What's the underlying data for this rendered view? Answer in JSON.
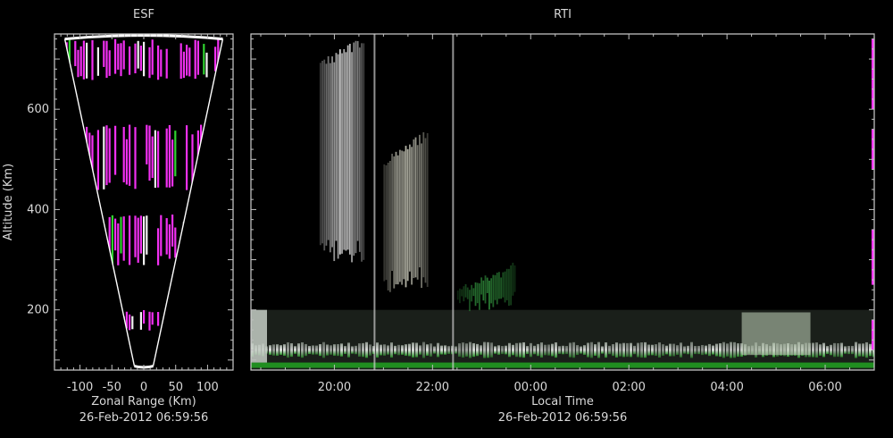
{
  "chart_data": [
    {
      "type": "heatmap",
      "title": "ESF",
      "xlabel": "Zonal Range (Km)",
      "ylabel": "Altitude (Km)",
      "timestamp": "26-Feb-2012 06:59:56",
      "xlim": [
        -140,
        140
      ],
      "ylim": [
        80,
        750
      ],
      "x_ticks": [
        -100,
        -50,
        0,
        50,
        100
      ],
      "x_tick_labels": [
        "-100",
        "-50",
        "0",
        "50",
        "100"
      ],
      "y_ticks": [
        200,
        400,
        600
      ],
      "y_tick_labels": [
        "200",
        "400",
        "600"
      ],
      "fan_half_angle_deg": 9.5,
      "echo_bands_altitude_km": [
        [
          160,
          200
        ],
        [
          290,
          390
        ],
        [
          440,
          570
        ],
        [
          660,
          740
        ]
      ],
      "colors": {
        "echo": "#ff33ff",
        "frame": "#ffffff"
      }
    },
    {
      "type": "heatmap",
      "title": "RTI",
      "xlabel": "Local Time",
      "timestamp": "26-Feb-2012 06:59:56",
      "x_range_hours": [
        18.3,
        31.0
      ],
      "ylim": [
        80,
        750
      ],
      "x_ticks": [
        20,
        22,
        24,
        26,
        28,
        30
      ],
      "x_tick_labels": [
        "20:00",
        "22:00",
        "00:00",
        "02:00",
        "04:00",
        "06:00"
      ],
      "y_ticks": [
        200,
        400,
        600
      ],
      "plumes": [
        {
          "t_start": 19.7,
          "t_end": 20.6,
          "alt_low_km": 310,
          "alt_high_km": 750,
          "color": "#e8e8e8"
        },
        {
          "t_start": 21.0,
          "t_end": 21.9,
          "alt_low_km": 250,
          "alt_high_km": 560,
          "color": "#d0d0c0"
        },
        {
          "t_start": 22.5,
          "t_end": 23.7,
          "alt_low_km": 210,
          "alt_high_km": 300,
          "color": "#2f8a3a"
        }
      ],
      "colors": {
        "low_layer": "#e0e0e0",
        "green": "#22aa22"
      }
    }
  ]
}
